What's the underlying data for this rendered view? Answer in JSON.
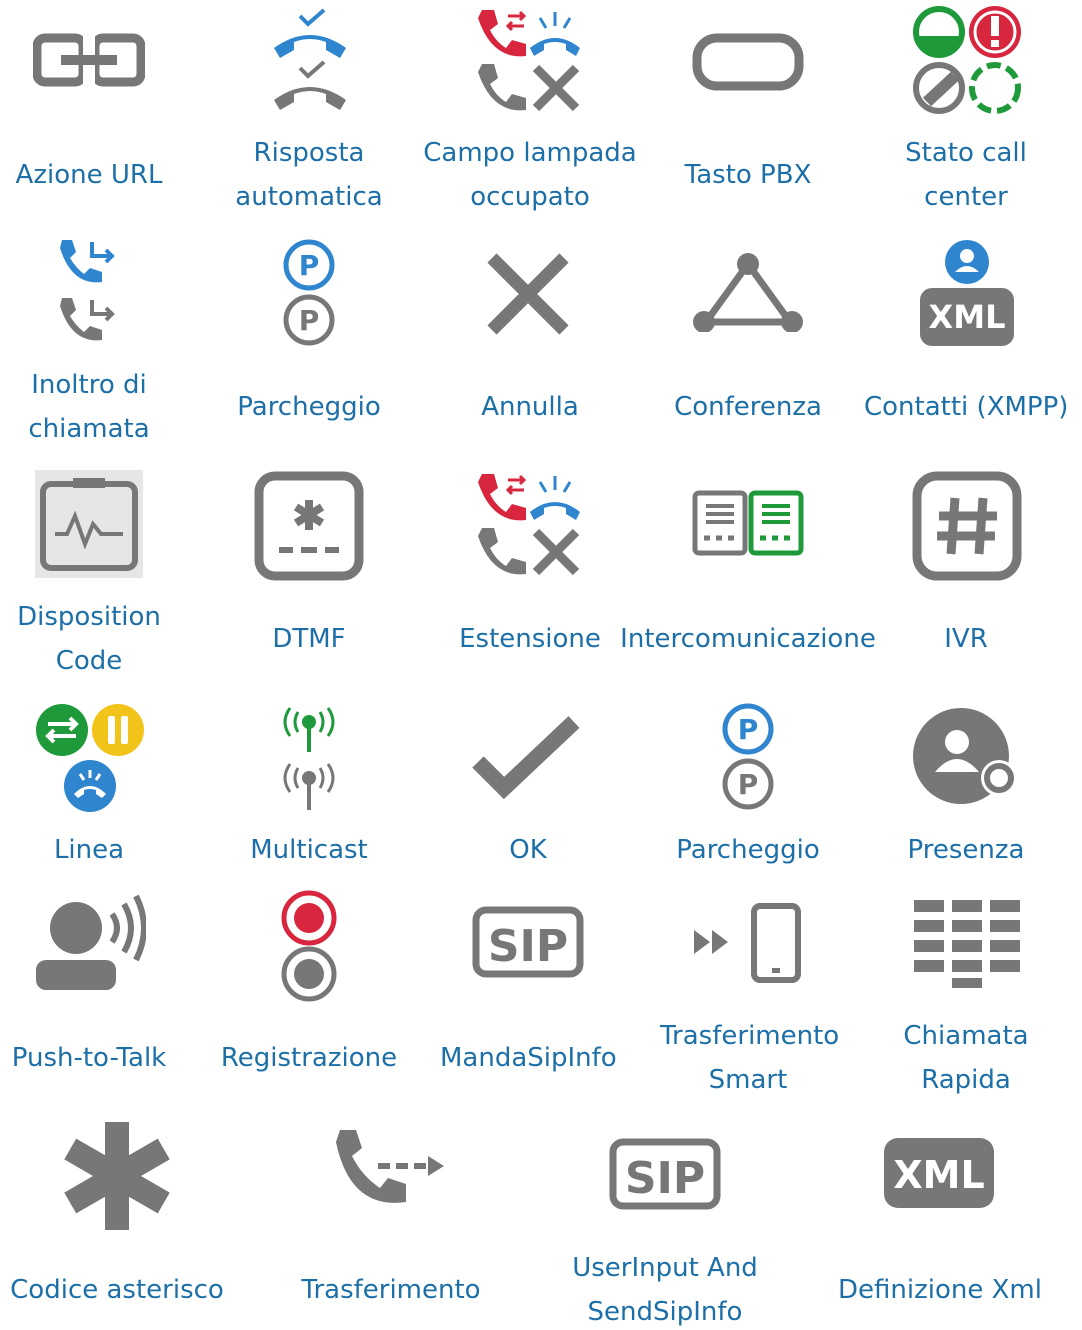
{
  "colors": {
    "label": "#1d6fa8",
    "icon_gray": "#777777",
    "icon_blue": "#2f86cf",
    "icon_red": "#d7263d",
    "icon_green": "#1f9a3a",
    "icon_yellow": "#f2c318"
  },
  "grid": {
    "row1": [
      {
        "label": "Azione URL",
        "icon": "link-icon"
      },
      {
        "label": "Risposta\nautomatica",
        "icon": "auto-answer-icon"
      },
      {
        "label": "Campo lampada\noccupato",
        "icon": "busy-lamp-field-icon"
      },
      {
        "label": "Tasto PBX",
        "icon": "pbx-key-icon"
      },
      {
        "label": "Stato call\ncenter",
        "icon": "call-center-status-icon"
      }
    ],
    "row2": [
      {
        "label": "Inoltro di\nchiamata",
        "icon": "call-forward-icon"
      },
      {
        "label": "Parcheggio",
        "icon": "park-icon"
      },
      {
        "label": "Annulla",
        "icon": "cancel-x-icon"
      },
      {
        "label": "Conferenza",
        "icon": "conference-icon"
      },
      {
        "label": "Contatti (XMPP)",
        "icon": "xmpp-contacts-icon"
      }
    ],
    "row3": [
      {
        "label": "Disposition\nCode",
        "icon": "disposition-code-icon"
      },
      {
        "label": "DTMF",
        "icon": "dtmf-icon"
      },
      {
        "label": "Estensione",
        "icon": "extension-icon"
      },
      {
        "label": "Intercomunicazione",
        "icon": "intercom-icon"
      },
      {
        "label": "IVR",
        "icon": "ivr-hash-icon"
      }
    ],
    "row4": [
      {
        "label": "Linea",
        "icon": "line-icon"
      },
      {
        "label": "Multicast",
        "icon": "multicast-icon"
      },
      {
        "label": "OK",
        "icon": "ok-check-icon"
      },
      {
        "label": "Parcheggio",
        "icon": "park-icon"
      },
      {
        "label": "Presenza",
        "icon": "presence-icon"
      }
    ],
    "row5": [
      {
        "label": "Push-to-Talk",
        "icon": "push-to-talk-icon"
      },
      {
        "label": "Registrazione",
        "icon": "record-icon"
      },
      {
        "label": "MandaSipInfo",
        "icon": "sip-icon"
      },
      {
        "label": "Trasferimento\nSmart",
        "icon": "smart-transfer-icon"
      },
      {
        "label": "Chiamata\nRapida",
        "icon": "speed-dial-icon"
      }
    ],
    "row6": [
      {
        "label": "Codice asterisco",
        "icon": "asterisk-icon"
      },
      {
        "label": "Trasferimento",
        "icon": "transfer-icon"
      },
      {
        "label": "UserInput And\nSendSipInfo",
        "icon": "sip-icon"
      },
      {
        "label": "Definizione Xml",
        "icon": "xml-icon"
      }
    ]
  },
  "icon_text": {
    "park": "P",
    "xml": "XML",
    "sip": "SIP"
  }
}
